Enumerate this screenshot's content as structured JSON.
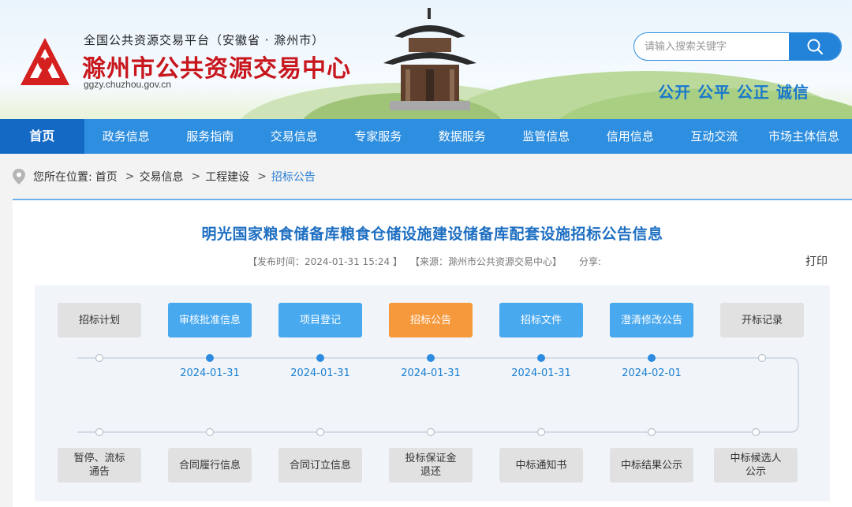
{
  "header": {
    "platform_name": "全国公共资源交易平台（安徽省 · 滁州市）",
    "site_title": "滁州市公共资源交易中心",
    "site_url": "ggzy.chuzhou.gov.cn",
    "slogan": "公开 公平 公正 诚信",
    "search": {
      "placeholder": "请输入搜索关键字"
    }
  },
  "nav": {
    "items": [
      {
        "label": "首页",
        "active": true
      },
      {
        "label": "政务信息"
      },
      {
        "label": "服务指南"
      },
      {
        "label": "交易信息"
      },
      {
        "label": "专家服务"
      },
      {
        "label": "数据服务"
      },
      {
        "label": "监管信息"
      },
      {
        "label": "信用信息"
      },
      {
        "label": "互动交流"
      },
      {
        "label": "市场主体信息"
      }
    ]
  },
  "breadcrumb": {
    "prefix": "您所在位置:",
    "items": [
      "首页",
      "交易信息",
      "工程建设",
      "招标公告"
    ]
  },
  "article": {
    "title": "明光国家粮食储备库粮食仓储设施建设储备库配套设施招标公告信息",
    "publish_time": "【发布时间：2024-01-31 15:24 】",
    "source": "【来源：滁州市公共资源交易中心】",
    "share": "分享:",
    "print": "打印"
  },
  "flow": {
    "top_steps": [
      {
        "label": "招标计划",
        "state": "grey"
      },
      {
        "label": "审核批准信息",
        "state": "blue"
      },
      {
        "label": "项目登记",
        "state": "blue"
      },
      {
        "label": "招标公告",
        "state": "orange"
      },
      {
        "label": "招标文件",
        "state": "blue"
      },
      {
        "label": "澄清修改公告",
        "state": "blue"
      },
      {
        "label": "开标记录",
        "state": "grey"
      }
    ],
    "dates": [
      "2024-01-31",
      "2024-01-31",
      "2024-01-31",
      "2024-01-31",
      "2024-02-01"
    ],
    "bottom_steps": [
      {
        "label": "暂停、流标\n通告",
        "state": "grey"
      },
      {
        "label": "合同履行信息",
        "state": "grey"
      },
      {
        "label": "合同订立信息",
        "state": "grey"
      },
      {
        "label": "投标保证金\n退还",
        "state": "grey"
      },
      {
        "label": "中标通知书",
        "state": "grey"
      },
      {
        "label": "中标结果公示",
        "state": "grey"
      },
      {
        "label": "中标候选人\n公示",
        "state": "grey"
      }
    ]
  },
  "colors": {
    "nav_bg": "#2e8edf",
    "nav_active": "#1369c4",
    "title_red": "#c8161d",
    "link_blue": "#1e6fc2",
    "step_blue": "#49a9ef",
    "step_orange": "#f6993d",
    "step_grey": "#e1e1e1"
  }
}
